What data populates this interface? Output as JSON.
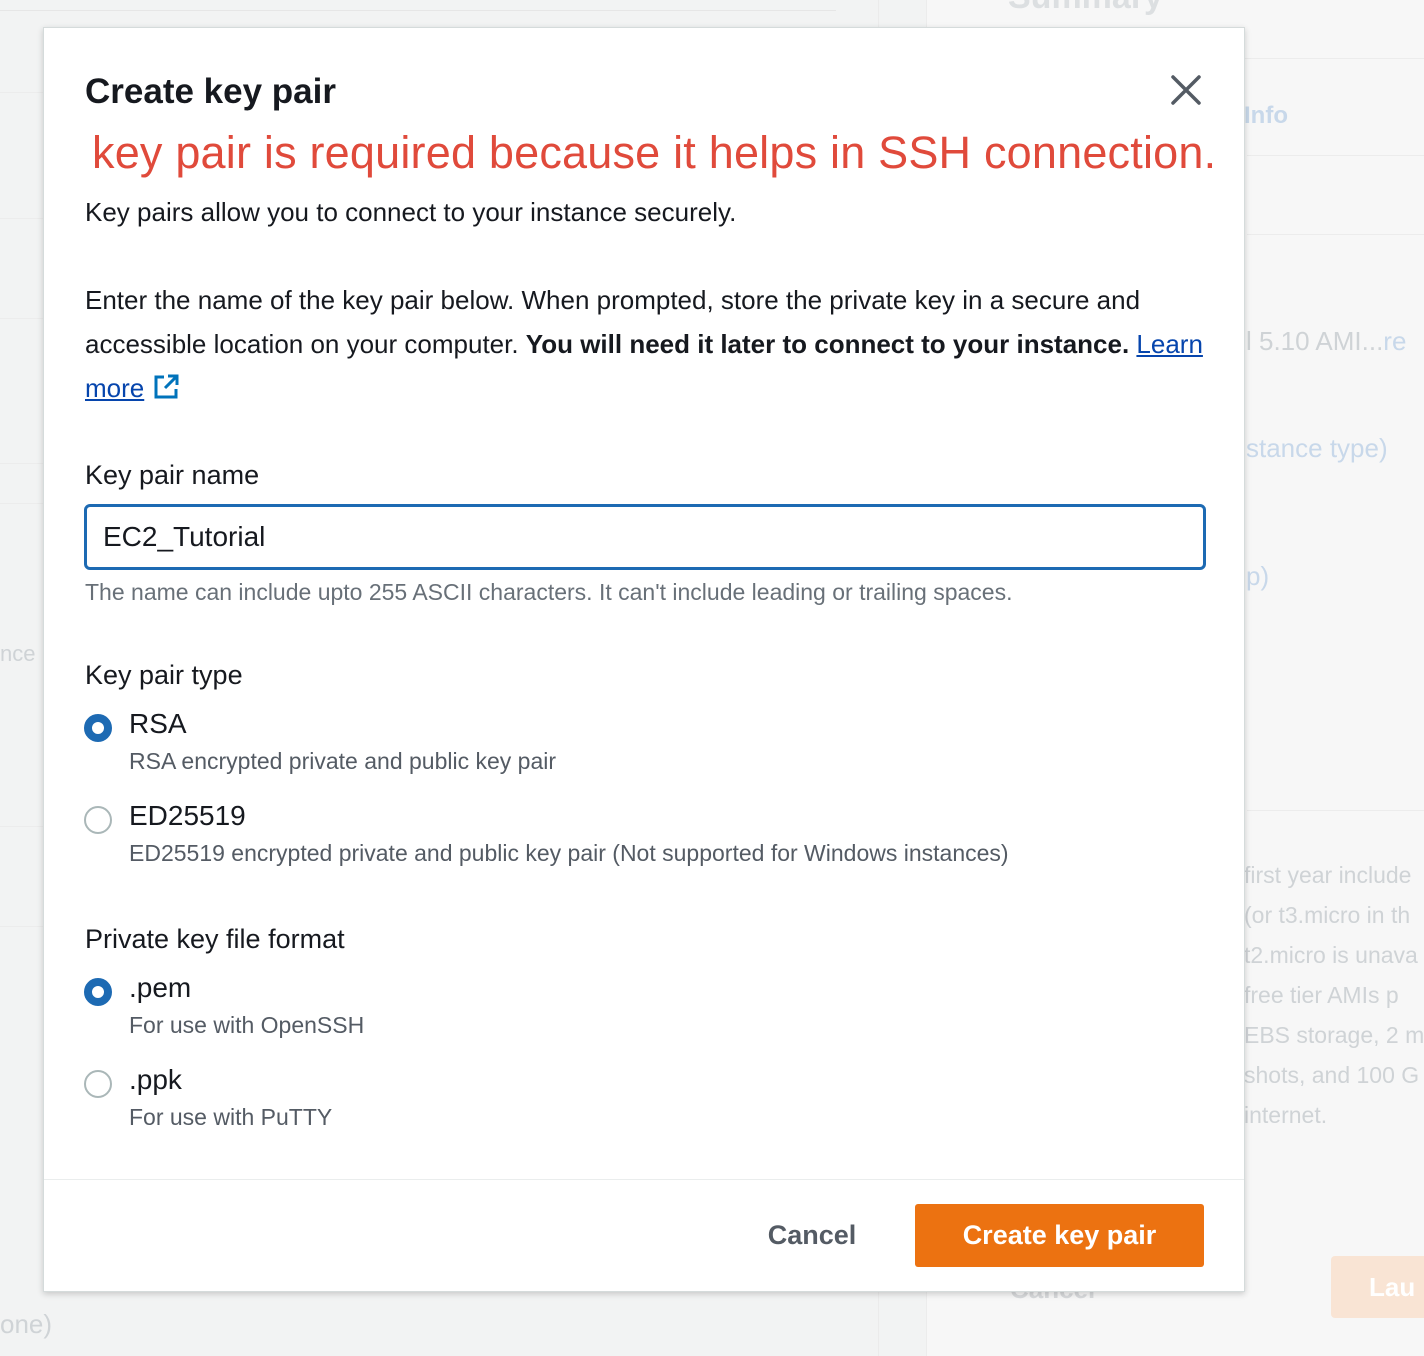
{
  "background": {
    "summary_heading": "Summary",
    "info_link": "Info",
    "ami_snippet": "l 5.10 AMI...",
    "ami_link_snippet": "re",
    "instance_type_snippet": "stance type)",
    "group_snippet": "p)",
    "left_snippet": "nce",
    "bottom_left_snippet": "one)",
    "free_tier_lines": [
      "first year include",
      "(or t3.micro in th",
      "t2.micro is unava",
      "free tier AMIs p",
      "EBS storage, 2 m",
      "shots, and 100 G",
      "internet."
    ],
    "cancel_snippet": "Cancel",
    "launch_snippet": "Lau"
  },
  "modal": {
    "title": "Create key pair",
    "annotation": "key pair is required because it helps in SSH connection.",
    "intro": "Key pairs allow you to connect to your instance securely.",
    "instructions_plain": "Enter the name of the key pair below. When prompted, store the private key in a secure and accessible location on your computer. ",
    "instructions_bold": "You will need it later to connect to your instance.",
    "learn_more": "Learn more",
    "name_field": {
      "label": "Key pair name",
      "value": "EC2_Tutorial",
      "hint": "The name can include upto 255 ASCII characters. It can't include leading or trailing spaces."
    },
    "key_type": {
      "label": "Key pair type",
      "options": [
        {
          "label": "RSA",
          "description": "RSA encrypted private and public key pair",
          "selected": true
        },
        {
          "label": "ED25519",
          "description": "ED25519 encrypted private and public key pair (Not supported for Windows instances)",
          "selected": false
        }
      ]
    },
    "file_format": {
      "label": "Private key file format",
      "options": [
        {
          "label": ".pem",
          "description": "For use with OpenSSH",
          "selected": true
        },
        {
          "label": ".ppk",
          "description": "For use with PuTTY",
          "selected": false
        }
      ]
    },
    "buttons": {
      "cancel": "Cancel",
      "create": "Create key pair"
    }
  },
  "colors": {
    "primary_button": "#ec7211",
    "selected_radio": "#1d6ab3",
    "annotation": "#e04a3b",
    "link": "#0645ad"
  }
}
